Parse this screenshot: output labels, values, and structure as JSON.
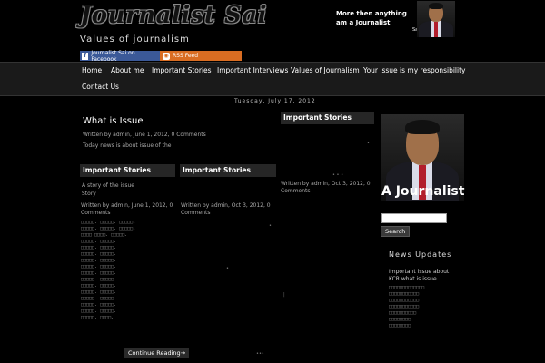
{
  "header": {
    "site_title": "Journalist Sai",
    "tagline": "Values of journalism",
    "quote": "More then anything am a Journalist",
    "signature": "Sai"
  },
  "social": {
    "facebook_label": "Journalist Sai on Facebook",
    "rss_label": "RSS Feed"
  },
  "nav": {
    "items": [
      "Home",
      "About me",
      "Important Stories",
      "Important Interviews",
      "Values of Journalism",
      "Your issue is my responsibility",
      "Contact Us"
    ]
  },
  "post": {
    "date": "Tuesday, July 17, 2012",
    "title": "What is Issue",
    "meta": "Written by admin, June 1, 2012, 0 Comments",
    "excerpt": "Today news is about issue of the"
  },
  "boxes": {
    "left_head": "Important Stories",
    "middle_head": "Important Stories",
    "right_head": "Important Stories",
    "left_title_line1": "A story of the issue",
    "left_title_line2": "Story",
    "left_meta": "Written by admin, June 1, 2012, 0 Comments",
    "middle_meta": "Written by admin, Oct 3, 2012, 0 Comments",
    "right_meta": "Written by admin, Oct 3, 2012, 0 Comments",
    "continue_label": "Continue Reading→"
  },
  "sidebar": {
    "caption": "A Journalist",
    "search_button": "Search",
    "news_head": "News Updates",
    "news_item": "Important issue about KCR what is issue"
  },
  "colors": {
    "background": "#000000",
    "nav_bg": "#1a1a1a",
    "facebook": "#3b5998",
    "rss": "#d96d22"
  }
}
